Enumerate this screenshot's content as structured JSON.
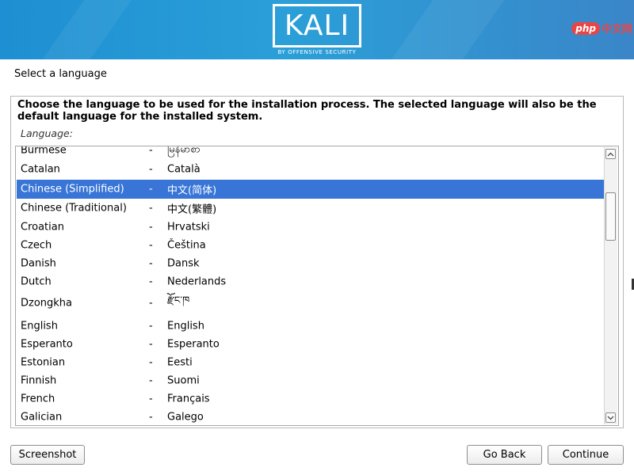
{
  "banner": {
    "logo_text": "KALI",
    "logo_subtitle": "BY OFFENSIVE SECURITY",
    "watermark_badge": "php",
    "watermark_text": "中文网",
    "colors": {
      "banner": "#2a9fd8",
      "selection": "#3875d7"
    }
  },
  "page": {
    "title": "Select a language",
    "description": "Choose the language to be used for the installation process. The selected language will also be the default language for the installed system.",
    "list_label": "Language:"
  },
  "languages": [
    {
      "name": "Burmese",
      "native": "မြန်မာစာ",
      "selected": false
    },
    {
      "name": "Catalan",
      "native": "Català",
      "selected": false
    },
    {
      "name": "Chinese (Simplified)",
      "native": "中文(简体)",
      "selected": true
    },
    {
      "name": "Chinese (Traditional)",
      "native": "中文(繁體)",
      "selected": false
    },
    {
      "name": "Croatian",
      "native": "Hrvatski",
      "selected": false
    },
    {
      "name": "Czech",
      "native": "Čeština",
      "selected": false
    },
    {
      "name": "Danish",
      "native": "Dansk",
      "selected": false
    },
    {
      "name": "Dutch",
      "native": "Nederlands",
      "selected": false
    },
    {
      "name": "Dzongkha",
      "native": "རྫོང་ཁ",
      "selected": false
    },
    {
      "name": "English",
      "native": "English",
      "selected": false
    },
    {
      "name": "Esperanto",
      "native": "Esperanto",
      "selected": false
    },
    {
      "name": "Estonian",
      "native": "Eesti",
      "selected": false
    },
    {
      "name": "Finnish",
      "native": "Suomi",
      "selected": false
    },
    {
      "name": "French",
      "native": "Français",
      "selected": false
    },
    {
      "name": "Galician",
      "native": "Galego",
      "selected": false
    }
  ],
  "separator": "-",
  "buttons": {
    "screenshot": "Screenshot",
    "go_back": "Go Back",
    "continue": "Continue"
  }
}
